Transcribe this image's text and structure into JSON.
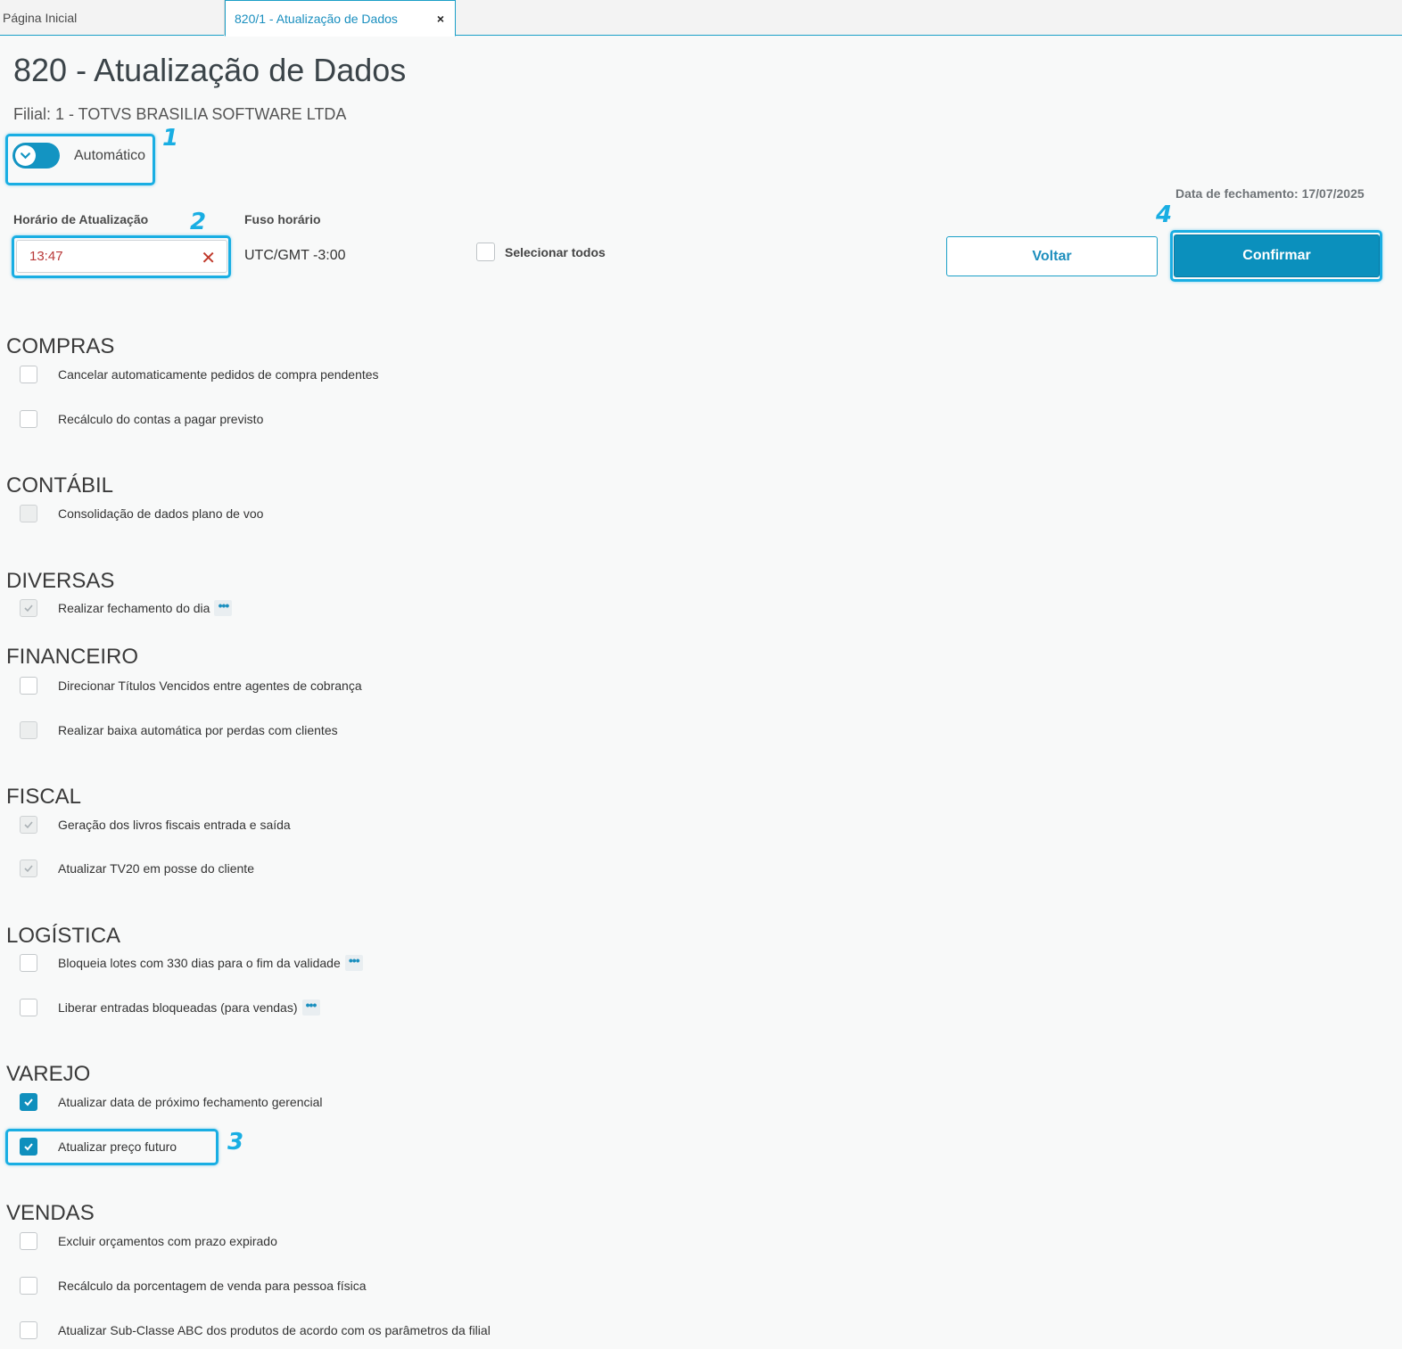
{
  "tabs": [
    {
      "label": "Página Inicial"
    },
    {
      "label": "820/1 - Atualização de Dados",
      "close": "×"
    }
  ],
  "page_title": "820 - Atualização de Dados",
  "filial": "Filial: 1 - TOTVS BRASILIA SOFTWARE LTDA",
  "mode_toggle": {
    "label": "Automático",
    "on": true
  },
  "closing_date": "Data de fechamento: 17/07/2025",
  "update_time": {
    "label": "Horário de Atualização",
    "value": "13:47"
  },
  "timezone": {
    "label": "Fuso horário",
    "value": "UTC/GMT -3:00"
  },
  "select_all": {
    "label": "Selecionar todos",
    "checked": false
  },
  "buttons": {
    "back": "Voltar",
    "confirm": "Confirmar"
  },
  "markers": [
    "1",
    "2",
    "3",
    "4"
  ],
  "sections": [
    {
      "title": "COMPRAS",
      "items": [
        {
          "label": "Cancelar automaticamente pedidos de compra pendentes",
          "state": "unchecked"
        },
        {
          "label": "Recálculo do contas a pagar previsto",
          "state": "unchecked"
        }
      ]
    },
    {
      "title": "CONTÁBIL",
      "items": [
        {
          "label": "Consolidação de dados plano de voo",
          "state": "disabled"
        }
      ]
    },
    {
      "title": "DIVERSAS",
      "items": [
        {
          "label": "Realizar fechamento do dia",
          "state": "disabled-checked",
          "more": "•••"
        }
      ]
    },
    {
      "title": "FINANCEIRO",
      "items": [
        {
          "label": "Direcionar Títulos Vencidos entre agentes de cobrança",
          "state": "unchecked"
        },
        {
          "label": "Realizar baixa automática por perdas com clientes",
          "state": "disabled"
        }
      ]
    },
    {
      "title": "FISCAL",
      "items": [
        {
          "label": "Geração dos livros fiscais entrada e saída",
          "state": "disabled-checked"
        },
        {
          "label": "Atualizar TV20 em posse do cliente",
          "state": "disabled-checked"
        }
      ]
    },
    {
      "title": "LOGÍSTICA",
      "items": [
        {
          "label": "Bloqueia lotes com 330 dias para o fim da validade",
          "state": "unchecked",
          "more": "•••"
        },
        {
          "label": "Liberar entradas bloqueadas (para vendas)",
          "state": "unchecked",
          "more": "•••"
        }
      ]
    },
    {
      "title": "VAREJO",
      "items": [
        {
          "label": "Atualizar data de próximo fechamento gerencial",
          "state": "checked"
        },
        {
          "label": "Atualizar preço futuro",
          "state": "checked"
        }
      ]
    },
    {
      "title": "VENDAS",
      "items": [
        {
          "label": "Excluir orçamentos com prazo expirado",
          "state": "unchecked"
        },
        {
          "label": "Recálculo da porcentagem de venda para pessoa física",
          "state": "unchecked"
        },
        {
          "label": "Atualizar Sub-Classe ABC dos produtos de acordo com os parâmetros da filial",
          "state": "unchecked"
        }
      ]
    }
  ],
  "colors": {
    "accent": "#0b90bd",
    "highlight": "#19aee3",
    "error": "#c0392b"
  }
}
